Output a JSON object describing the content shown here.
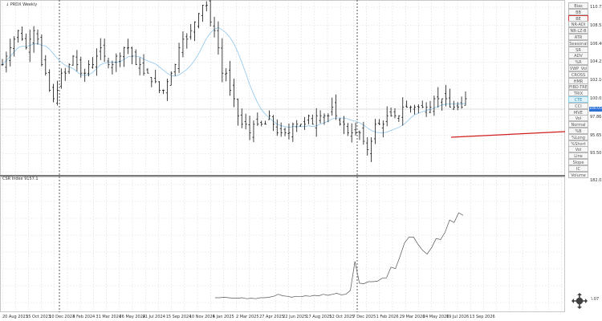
{
  "chart": {
    "symbol_label": "↓ PRDX Weekly",
    "indicator_label": "CSR Index  9157.1",
    "price_ticks": [
      "110.75",
      "108.55",
      "106.40",
      "104.25",
      "102.10",
      "100.05",
      "97.86",
      "95.65",
      "93.50"
    ],
    "last_price": "100.05",
    "indicator_ticks": [
      "182.05",
      "5.07"
    ],
    "date_labels": [
      "20 Aug 2023",
      "15 Oct 2023",
      "10 Dec 2023",
      "4 Feb 2024",
      "31 Mar 2024",
      "26 May 2024",
      "21 Jul 2024",
      "15 Sep 2024",
      "10 Nov 2024",
      "5 Jan 2025",
      "2 Mar 2025",
      "27 Apr 2025",
      "22 Jun 2025",
      "17 Aug 2025",
      "12 Oct 2025",
      "7 Dec 2025",
      "1 Feb 2026",
      "29 Mar 2026",
      "24 May 2026",
      "19 Jul 2026",
      "13 Sep 2026"
    ]
  },
  "toolbar": {
    "buttons": [
      "Bias",
      "BB",
      "BE",
      "NR-ADI",
      "NR-LZ-B",
      "ATR",
      "Seasonal",
      "SR",
      "ADV",
      "%R",
      "VWP_Vol",
      "CROSS",
      "HMR",
      "FIBO-TRE",
      "TRIX",
      "CTE",
      "CCI",
      "MVE",
      "Vol",
      "Normal",
      "%B",
      "%Long",
      "%Short",
      "Vol",
      "Line",
      "Slope",
      "IC",
      "Volume"
    ]
  },
  "icons": {
    "zoom": "zoom-icon"
  }
}
